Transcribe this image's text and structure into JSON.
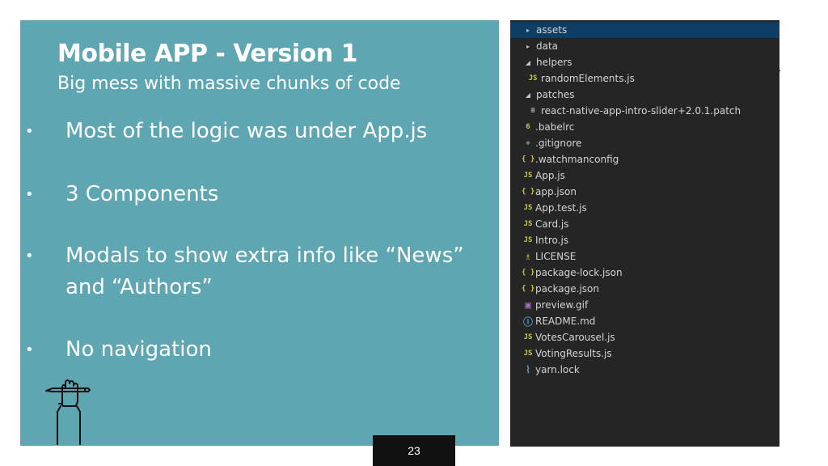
{
  "slide": {
    "title": "Mobile APP - Version 1",
    "subtitle": "Big mess with massive chunks of code",
    "bullets": [
      {
        "marker": "•",
        "text": "Most of the logic was under App.js"
      },
      {
        "marker": "•",
        "text": "3 Components"
      },
      {
        "marker": "•",
        "text": "Modals to show extra info like “News” and “Authors”"
      },
      {
        "marker": "•",
        "text": "No navigation"
      }
    ],
    "panel_color": "#5fa6b3",
    "page_number": "23"
  },
  "explorer": {
    "background": "#252526",
    "selected_color": "#0e3e63",
    "items": [
      {
        "name": "assets",
        "arrow": "▸",
        "icon": "",
        "icon_name": "folder-closed-icon",
        "selected": true
      },
      {
        "name": "data",
        "arrow": "▸",
        "icon": "",
        "icon_name": "folder-closed-icon"
      },
      {
        "name": "helpers",
        "arrow": "◢",
        "icon": "",
        "icon_name": "folder-open-icon"
      },
      {
        "name": "randomElements.js",
        "arrow": "",
        "icon": "JS",
        "icon_name": "js-file-icon"
      },
      {
        "name": "patches",
        "arrow": "◢",
        "icon": "",
        "icon_name": "folder-open-icon"
      },
      {
        "name": "react-native-app-intro-slider+2.0.1.patch",
        "arrow": "",
        "icon": "≡",
        "icon_name": "patch-file-icon"
      },
      {
        "name": ".babelrc",
        "arrow": "",
        "icon": "6",
        "icon_name": "babel-file-icon"
      },
      {
        "name": ".gitignore",
        "arrow": "",
        "icon": "◆",
        "icon_name": "git-file-icon"
      },
      {
        "name": ".watchmanconfig",
        "arrow": "",
        "icon": "{ }",
        "icon_name": "json-file-icon"
      },
      {
        "name": "App.js",
        "arrow": "",
        "icon": "JS",
        "icon_name": "js-file-icon"
      },
      {
        "name": "app.json",
        "arrow": "",
        "icon": "{ }",
        "icon_name": "json-file-icon"
      },
      {
        "name": "App.test.js",
        "arrow": "",
        "icon": "JS",
        "icon_name": "js-file-icon"
      },
      {
        "name": "Card.js",
        "arrow": "",
        "icon": "JS",
        "icon_name": "js-file-icon"
      },
      {
        "name": "Intro.js",
        "arrow": "",
        "icon": "JS",
        "icon_name": "js-file-icon"
      },
      {
        "name": "LICENSE",
        "arrow": "",
        "icon": "♗",
        "icon_name": "license-file-icon"
      },
      {
        "name": "package-lock.json",
        "arrow": "",
        "icon": "{ }",
        "icon_name": "json-file-icon"
      },
      {
        "name": "package.json",
        "arrow": "",
        "icon": "{ }",
        "icon_name": "json-file-icon"
      },
      {
        "name": "preview.gif",
        "arrow": "",
        "icon": "▣",
        "icon_name": "image-file-icon"
      },
      {
        "name": "README.md",
        "arrow": "",
        "icon": "ⓘ",
        "icon_name": "info-file-icon"
      },
      {
        "name": "VotesCarousel.js",
        "arrow": "",
        "icon": "JS",
        "icon_name": "js-file-icon"
      },
      {
        "name": "VotingResults.js",
        "arrow": "",
        "icon": "JS",
        "icon_name": "js-file-icon"
      },
      {
        "name": "yarn.lock",
        "arrow": "",
        "icon": "⌇",
        "icon_name": "yarn-file-icon"
      }
    ]
  }
}
